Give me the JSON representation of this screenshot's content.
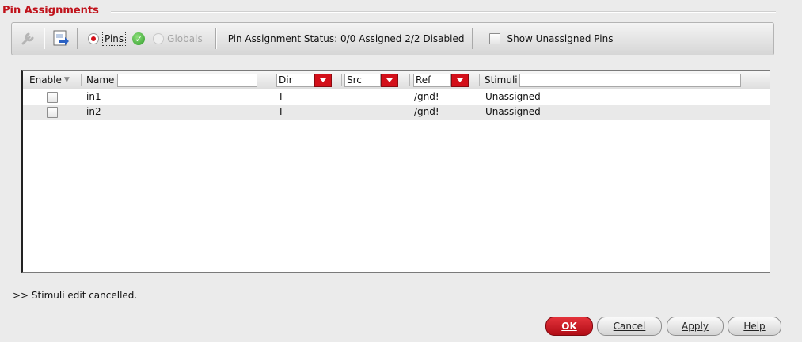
{
  "group": {
    "title": "Pin Assignments"
  },
  "toolbar": {
    "pins_label": "Pins",
    "globals_label": "Globals",
    "status_text": "Pin Assignment Status: 0/0 Assigned  2/2 Disabled",
    "show_unassigned_label": "Show Unassigned Pins"
  },
  "table": {
    "columns": {
      "enable": "Enable",
      "name": "Name",
      "dir": "Dir",
      "src": "Src",
      "ref": "Ref",
      "stimuli": "Stimuli"
    },
    "rows": [
      {
        "name": "in1",
        "dir": "I",
        "src": "-",
        "ref": "/gnd!",
        "stimuli": "Unassigned"
      },
      {
        "name": "in2",
        "dir": "I",
        "src": "-",
        "ref": "/gnd!",
        "stimuli": "Unassigned"
      }
    ]
  },
  "message": ">> Stimuli edit cancelled.",
  "buttons": {
    "ok": "OK",
    "cancel": "Cancel",
    "apply": "Apply",
    "help": "Help"
  },
  "colors": {
    "accent": "#d3101a",
    "background": "#ebebeb"
  }
}
